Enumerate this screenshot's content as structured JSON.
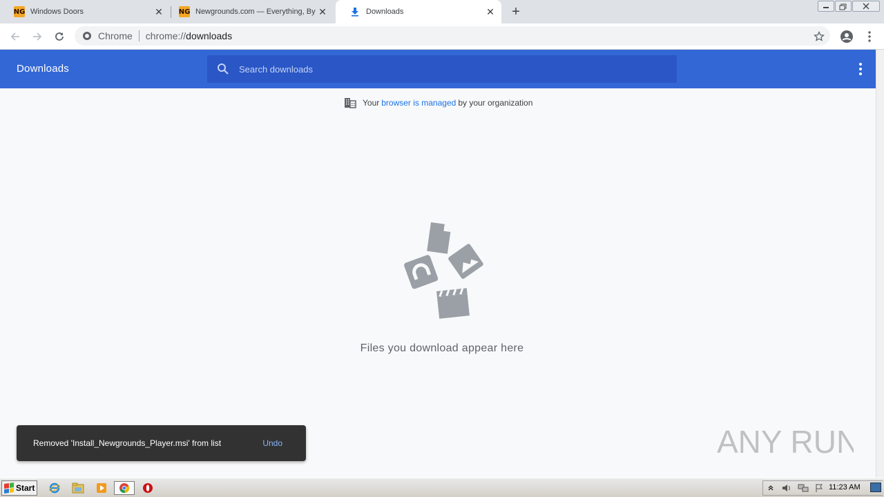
{
  "tabs": [
    {
      "title": "Windows Doors",
      "favicon": "newgrounds-icon"
    },
    {
      "title": "Newgrounds.com — Everything, By Everyone",
      "favicon": "newgrounds-icon"
    },
    {
      "title": "Downloads",
      "favicon": "download-icon"
    }
  ],
  "newgrounds_logo_text": "NG",
  "omnibox": {
    "scheme_label": "Chrome",
    "url_prefix": "chrome://",
    "url_host": "downloads"
  },
  "downloads": {
    "title": "Downloads",
    "search_placeholder": "Search downloads",
    "managed_prefix": "Your",
    "managed_link": "browser is managed",
    "managed_suffix": "by your organization",
    "empty_text": "Files you download appear here"
  },
  "toast": {
    "message": "Removed 'Install_Newgrounds_Player.msi' from list",
    "action": "Undo"
  },
  "watermark": "ANY RUN",
  "taskbar": {
    "start_label": "Start",
    "clock": "11:23 AM"
  },
  "colors": {
    "header_blue": "#3367d6",
    "search_blue": "#2a56c6",
    "link_blue": "#1a73e8",
    "toast_bg": "#323232",
    "toast_action": "#8ab4f8"
  }
}
